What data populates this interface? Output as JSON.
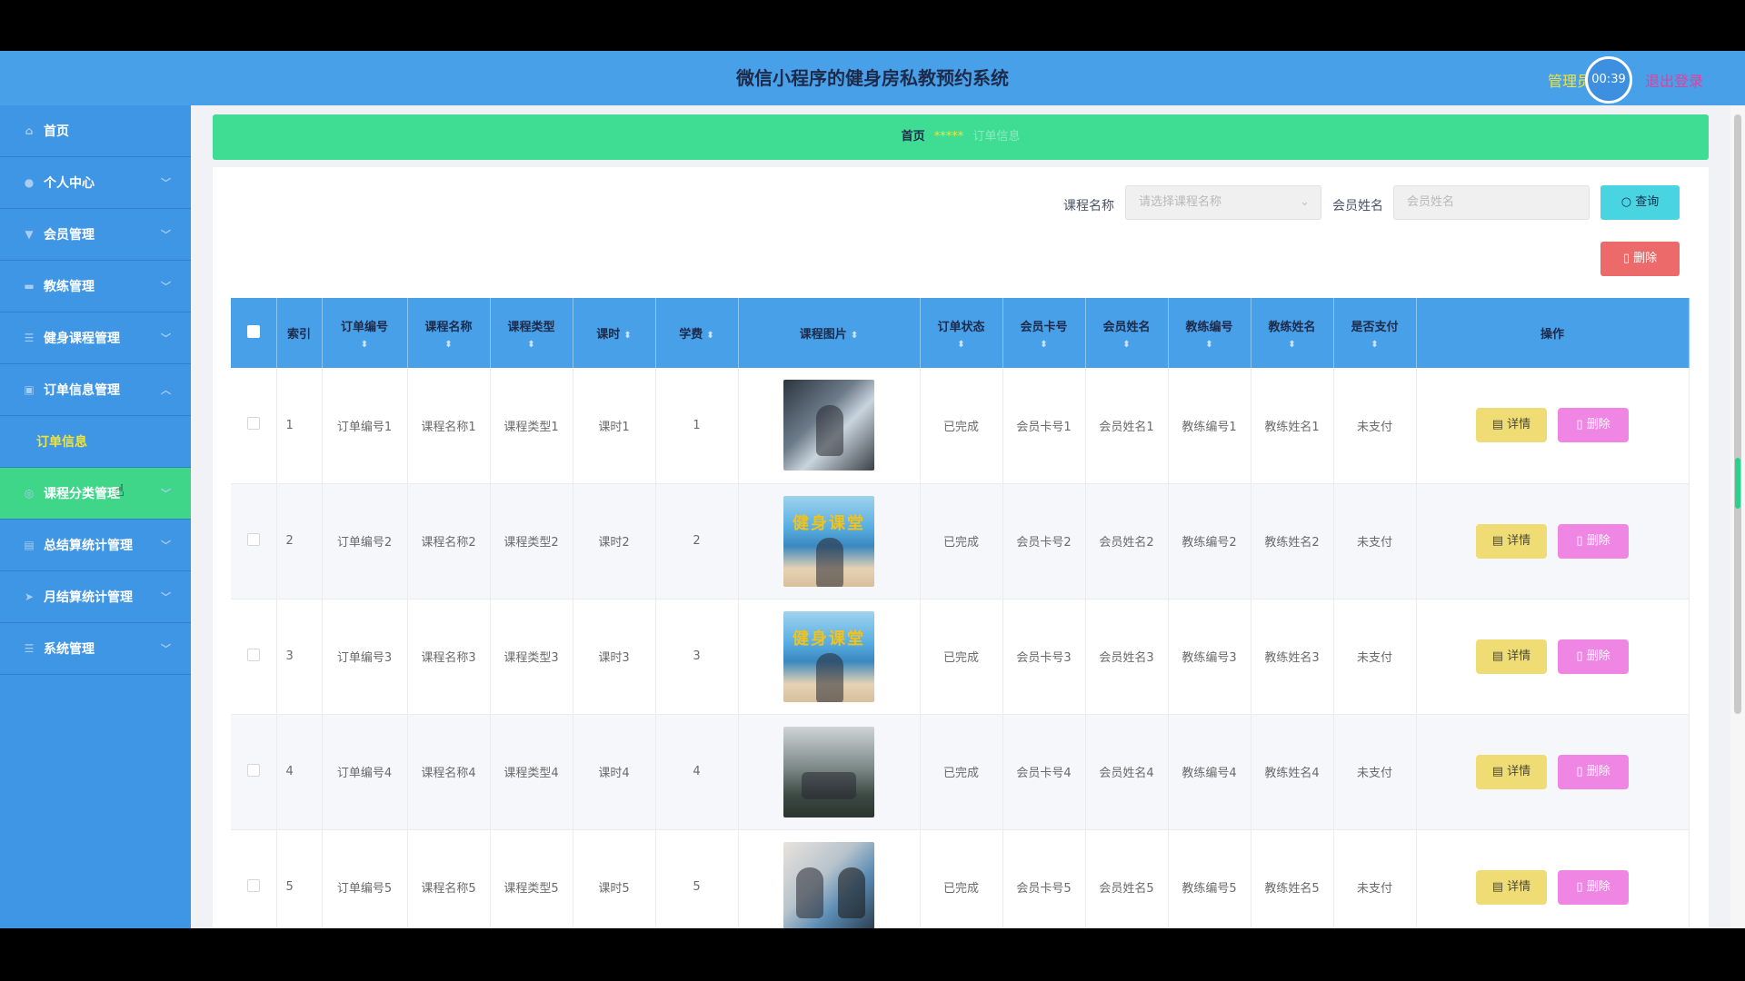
{
  "header": {
    "title": "微信小程序的健身房私教预约系统",
    "user_label": "管理员",
    "timer": "00:39",
    "logout_label": "退出登录"
  },
  "sidebar": {
    "items": [
      {
        "label": "首页",
        "icon": "home-icon"
      },
      {
        "label": "个人中心",
        "icon": "user-icon"
      },
      {
        "label": "会员管理",
        "icon": "member-icon"
      },
      {
        "label": "教练管理",
        "icon": "coach-icon"
      },
      {
        "label": "健身课程管理",
        "icon": "list-icon"
      },
      {
        "label": "订单信息管理",
        "icon": "briefcase-icon"
      },
      {
        "label": "课程分类管理",
        "icon": "category-icon"
      },
      {
        "label": "总结算统计管理",
        "icon": "ledger-icon"
      },
      {
        "label": "月结算统计管理",
        "icon": "send-icon"
      },
      {
        "label": "系统管理",
        "icon": "list-icon"
      }
    ],
    "sub_item": "订单信息"
  },
  "breadcrumb": {
    "home": "首页",
    "separator": "*****",
    "current": "订单信息"
  },
  "search": {
    "course_label": "课程名称",
    "course_placeholder": "请选择课程名称",
    "member_label": "会员姓名",
    "member_placeholder": "会员姓名",
    "query_label": "查询",
    "delete_label": "删除"
  },
  "table": {
    "headers": {
      "index": "索引",
      "order_no": "订单编号",
      "course_name": "课程名称",
      "course_type": "课程类型",
      "hours": "课时",
      "fee": "学费",
      "image": "课程图片",
      "status": "订单状态",
      "card_no": "会员卡号",
      "member_name": "会员姓名",
      "coach_no": "教练编号",
      "coach_name": "教练姓名",
      "paid": "是否支付",
      "actions": "操作"
    },
    "detail_label": "详情",
    "delete_label": "删除",
    "rows": [
      {
        "index": "1",
        "order_no": "订单编号1",
        "course_name": "课程名称1",
        "course_type": "课程类型1",
        "hours": "课时1",
        "fee": "1",
        "status": "已完成",
        "card_no": "会员卡号1",
        "member_name": "会员姓名1",
        "coach_no": "教练编号1",
        "coach_name": "教练姓名1",
        "paid": "未支付"
      },
      {
        "index": "2",
        "order_no": "订单编号2",
        "course_name": "课程名称2",
        "course_type": "课程类型2",
        "hours": "课时2",
        "fee": "2",
        "status": "已完成",
        "card_no": "会员卡号2",
        "member_name": "会员姓名2",
        "coach_no": "教练编号2",
        "coach_name": "教练姓名2",
        "paid": "未支付"
      },
      {
        "index": "3",
        "order_no": "订单编号3",
        "course_name": "课程名称3",
        "course_type": "课程类型3",
        "hours": "课时3",
        "fee": "3",
        "status": "已完成",
        "card_no": "会员卡号3",
        "member_name": "会员姓名3",
        "coach_no": "教练编号3",
        "coach_name": "教练姓名3",
        "paid": "未支付"
      },
      {
        "index": "4",
        "order_no": "订单编号4",
        "course_name": "课程名称4",
        "course_type": "课程类型4",
        "hours": "课时4",
        "fee": "4",
        "status": "已完成",
        "card_no": "会员卡号4",
        "member_name": "会员姓名4",
        "coach_no": "教练编号4",
        "coach_name": "教练姓名4",
        "paid": "未支付"
      },
      {
        "index": "5",
        "order_no": "订单编号5",
        "course_name": "课程名称5",
        "course_type": "课程类型5",
        "hours": "课时5",
        "fee": "5",
        "status": "已完成",
        "card_no": "会员卡号5",
        "member_name": "会员姓名5",
        "coach_no": "教练编号5",
        "coach_name": "教练姓名5",
        "paid": "未支付"
      }
    ],
    "thumb_banner": "健身课堂"
  },
  "colors": {
    "header": "#48a0e8",
    "sidebar": "#3f96e4",
    "active": "#3fd68a",
    "query": "#48d4e0",
    "delete": "#ec6a6a",
    "detail": "#f0dc74",
    "row_delete": "#ef86e4"
  }
}
